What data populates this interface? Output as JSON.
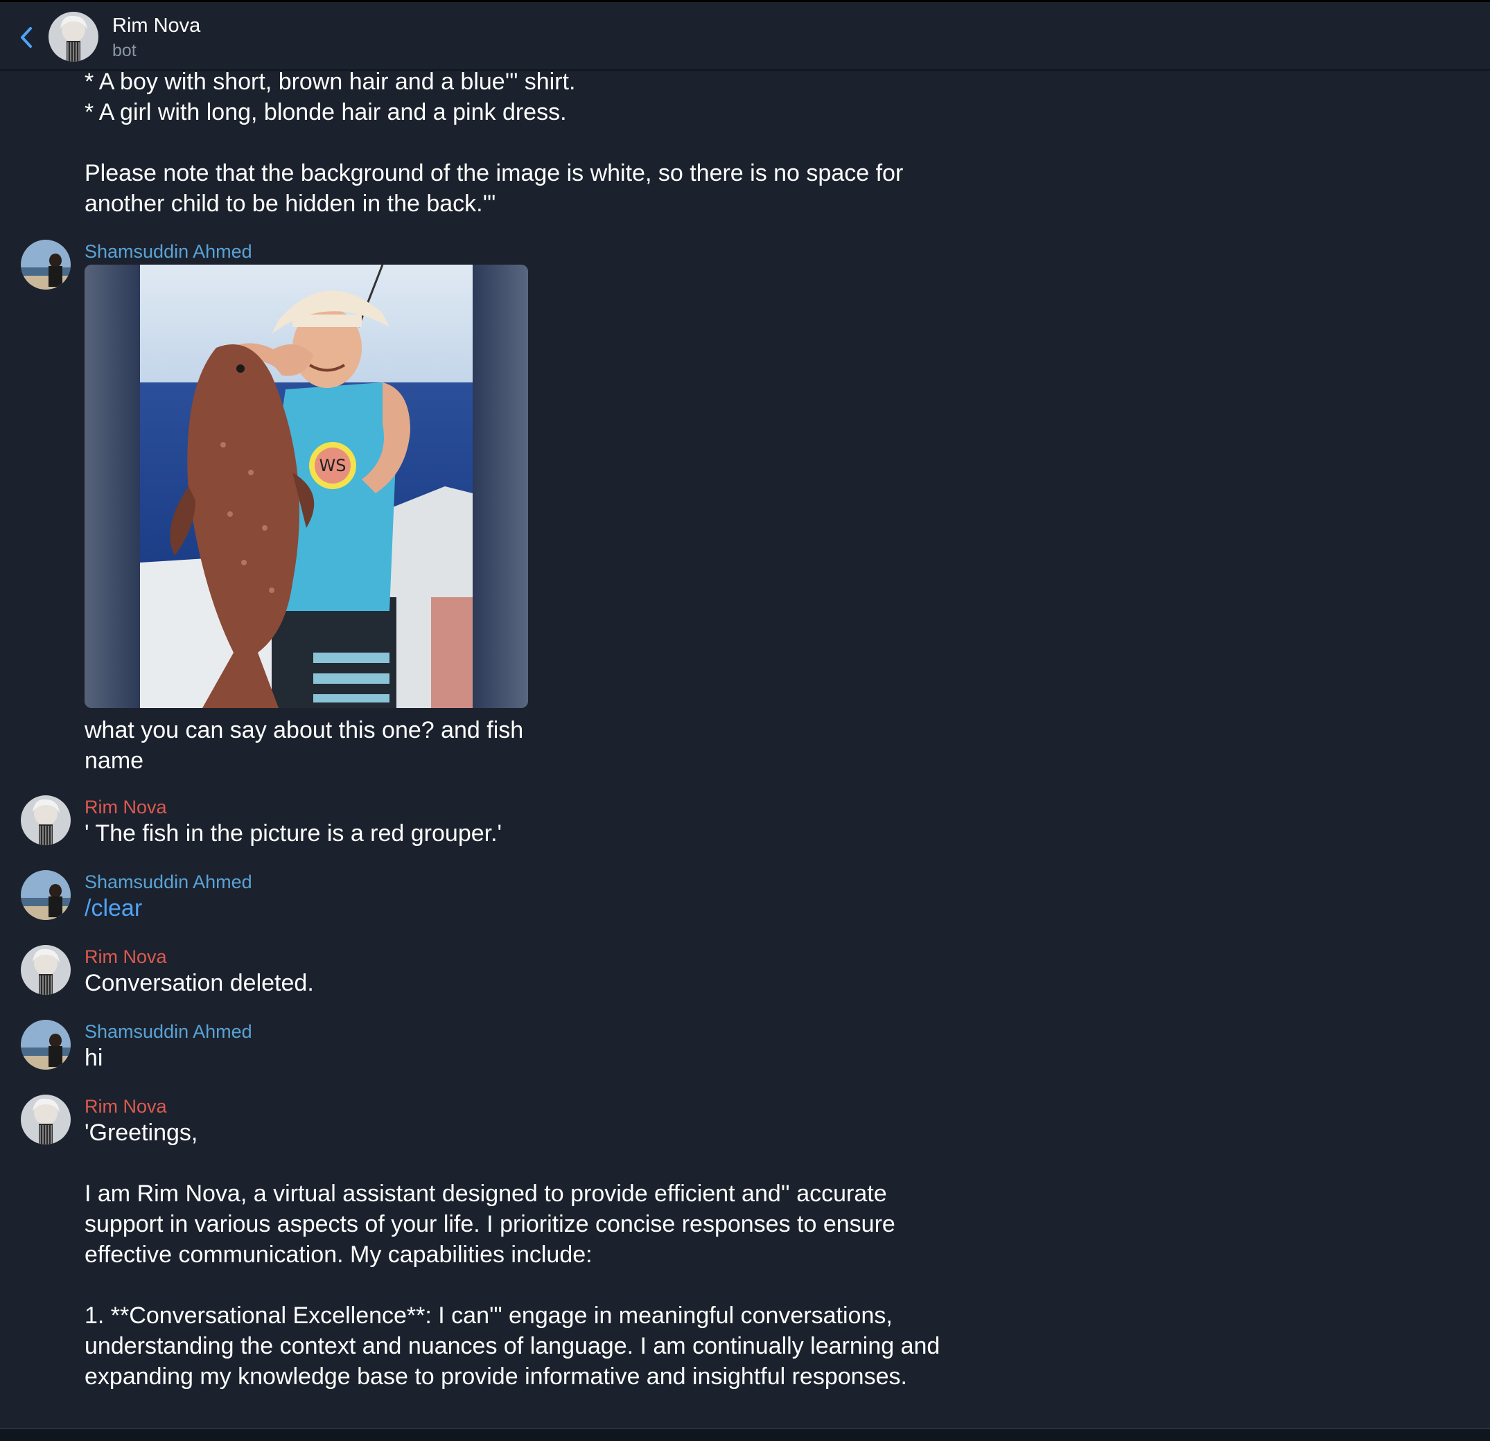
{
  "header": {
    "title": "Rim Nova",
    "subtitle": "bot",
    "back_icon": "chevron-left-icon",
    "accent": "#4fa3f7"
  },
  "colors": {
    "background": "#1b222d",
    "user_name": "#5aa2d6",
    "bot_name": "#dd5a50",
    "link": "#4fa3f7"
  },
  "messages": {
    "m0": {
      "text": "* A boy with short, brown hair and a blue'\" shirt.\n* A girl with long, blonde hair and a pink dress.\n\nPlease note that the background of the image is white, so there is no space for\nanother child to be hidden in the back.'\""
    },
    "m1": {
      "sender": "Shamsuddin Ahmed",
      "caption": "what you can say about this one? and fish\nname"
    },
    "m2": {
      "sender": "Rim Nova",
      "text": "' The fish in the picture is a red grouper.'"
    },
    "m3": {
      "sender": "Shamsuddin Ahmed",
      "text": "/clear"
    },
    "m4": {
      "sender": "Rim Nova",
      "text": "Conversation deleted."
    },
    "m5": {
      "sender": "Shamsuddin Ahmed",
      "text": "hi"
    },
    "m6": {
      "sender": "Rim Nova",
      "text": "'Greetings,\n\nI am Rim Nova, a virtual assistant designed to provide efficient and'' accurate\nsupport in various aspects of your life. I prioritize concise responses to ensure\neffective communication. My capabilities include:\n\n1. **Conversational Excellence**: I can'\" engage in meaningful conversations,\nunderstanding the context and nuances of language. I am continually learning and\nexpanding my knowledge base to provide informative and insightful responses."
    }
  }
}
